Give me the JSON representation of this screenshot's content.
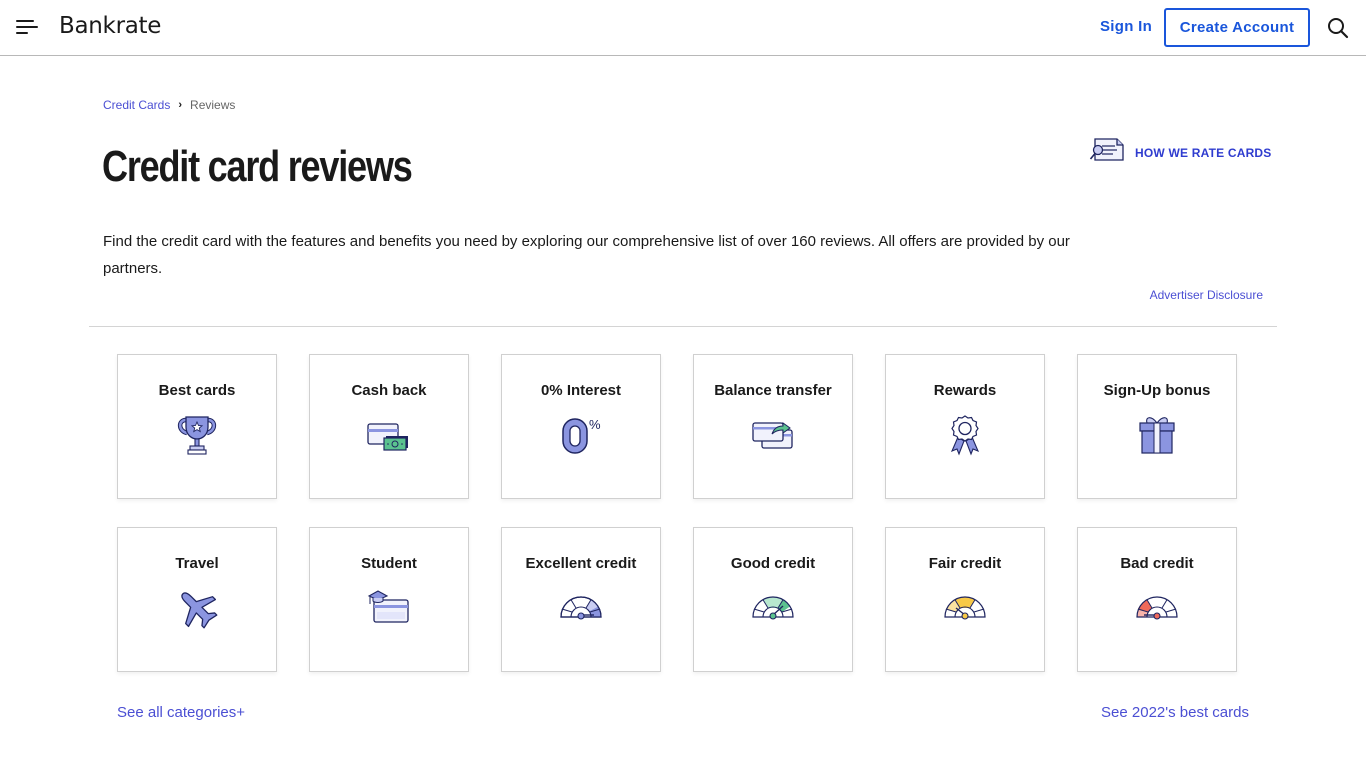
{
  "header": {
    "logo": "Bankrate",
    "sign_in": "Sign In",
    "create_account": "Create Account"
  },
  "breadcrumb": {
    "items": [
      {
        "label": "Credit Cards"
      },
      {
        "label": "Reviews"
      }
    ]
  },
  "page": {
    "title": "Credit card reviews",
    "how_we_rate": "HOW WE RATE CARDS",
    "intro": "Find the credit card with the features and benefits you need by exploring our comprehensive list of over 160 reviews. All offers are provided by our partners.",
    "advertiser_disclosure": "Advertiser Disclosure"
  },
  "categories": [
    {
      "label": "Best cards",
      "icon": "trophy-icon"
    },
    {
      "label": "Cash back",
      "icon": "card-cash-icon"
    },
    {
      "label": "0% Interest",
      "icon": "zero-percent-icon"
    },
    {
      "label": "Balance transfer",
      "icon": "card-transfer-icon"
    },
    {
      "label": "Rewards",
      "icon": "award-ribbon-icon"
    },
    {
      "label": "Sign-Up bonus",
      "icon": "gift-icon"
    },
    {
      "label": "Travel",
      "icon": "airplane-icon"
    },
    {
      "label": "Student",
      "icon": "graduation-card-icon"
    },
    {
      "label": "Excellent credit",
      "icon": "gauge-excellent-icon"
    },
    {
      "label": "Good credit",
      "icon": "gauge-good-icon"
    },
    {
      "label": "Fair credit",
      "icon": "gauge-fair-icon"
    },
    {
      "label": "Bad credit",
      "icon": "gauge-bad-icon"
    }
  ],
  "footer_links": {
    "see_all": "See all categories+",
    "see_best": "See 2022's best cards"
  },
  "colors": {
    "brand_blue": "#1a56db",
    "link": "#4b4fd3",
    "icon_fill": "#8b95e0",
    "icon_stroke": "#1f2560",
    "green": "#5bc28f",
    "yellow": "#f7c948",
    "red": "#ef6a5a"
  }
}
